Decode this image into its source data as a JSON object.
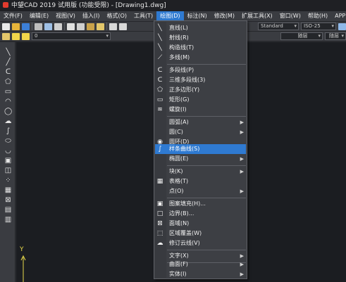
{
  "window": {
    "title": "中望CAD 2019 试用版 (功能受限) - [Drawing1.dwg]"
  },
  "menubar": [
    {
      "label": "文件(F)",
      "active": false
    },
    {
      "label": "编辑(E)",
      "active": false
    },
    {
      "label": "视图(V)",
      "active": false
    },
    {
      "label": "插入(I)",
      "active": false
    },
    {
      "label": "格式(O)",
      "active": false
    },
    {
      "label": "工具(T)",
      "active": false
    },
    {
      "label": "绘图(D)",
      "active": true
    },
    {
      "label": "标注(N)",
      "active": false
    },
    {
      "label": "修改(M)",
      "active": false
    },
    {
      "label": "扩展工具(X)",
      "active": false
    },
    {
      "label": "窗口(W)",
      "active": false
    },
    {
      "label": "帮助(H)",
      "active": false
    },
    {
      "label": "APP+",
      "active": false
    }
  ],
  "toolbar": {
    "text_style": "Standard",
    "dim_style": "ISO-25",
    "layer": "0",
    "linetype": "随层",
    "lineweight": "随层"
  },
  "draw_menu": {
    "items": [
      {
        "label": "直线(L)",
        "icon": "line-icon"
      },
      {
        "label": "射线(R)",
        "icon": "ray-icon"
      },
      {
        "label": "构造线(T)",
        "icon": "construction-line-icon"
      },
      {
        "label": "多线(M)",
        "icon": "multiline-icon"
      },
      {
        "label": "多段线(P)",
        "icon": "polyline-icon"
      },
      {
        "label": "三维多段线(3)",
        "icon": "3d-polyline-icon"
      },
      {
        "label": "正多边形(Y)",
        "icon": "polygon-icon"
      },
      {
        "label": "矩形(G)",
        "icon": "rectangle-icon"
      },
      {
        "label": "螺旋(I)",
        "icon": "helix-icon"
      },
      {
        "label": "圆弧(A)",
        "submenu": true
      },
      {
        "label": "圆(C)",
        "submenu": true
      },
      {
        "label": "圆环(D)",
        "icon": "donut-icon"
      },
      {
        "label": "样条曲线(S)",
        "icon": "spline-icon",
        "highlighted": true
      },
      {
        "label": "椭圆(E)",
        "submenu": true
      },
      {
        "label": "块(K)",
        "submenu": true
      },
      {
        "label": "表格(T)",
        "icon": "table-icon"
      },
      {
        "label": "点(O)",
        "submenu": true
      },
      {
        "label": "图案填充(H)...",
        "icon": "hatch-icon"
      },
      {
        "label": "边界(B)...",
        "icon": "boundary-icon"
      },
      {
        "label": "面域(N)",
        "icon": "region-icon"
      },
      {
        "label": "区域覆盖(W)",
        "icon": "wipeout-icon"
      },
      {
        "label": "修订云线(V)",
        "icon": "revcloud-icon"
      },
      {
        "label": "文字(X)",
        "submenu": true
      },
      {
        "label": "曲面(F)",
        "submenu": true
      },
      {
        "label": "实体(I)",
        "submenu": true
      }
    ]
  },
  "canvas": {
    "ucs_y_label": "Y"
  },
  "colors": {
    "accent": "#2f7ad1",
    "ucs": "#e8d94a"
  }
}
